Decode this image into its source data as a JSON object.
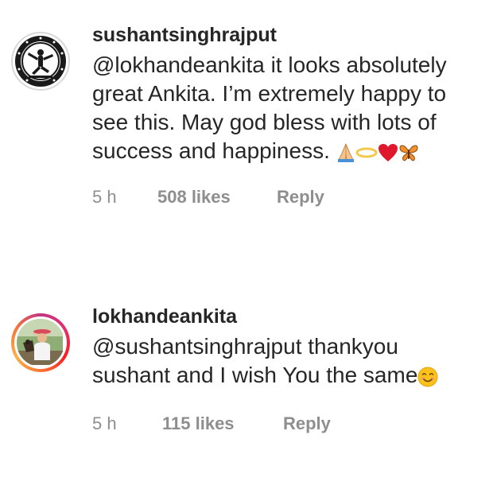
{
  "comments": [
    {
      "username": "sushantsinghrajput",
      "mention": "@lokhandeankita",
      "text": " it looks absolutely great Ankita. I’m extremely happy to see this. May god bless with lots of success and happiness.",
      "emojis": [
        "folded-hands-icon",
        "halo-icon",
        "red-heart-icon",
        "butterfly-icon"
      ],
      "time": "5 h",
      "likes": "508 likes",
      "reply": "Reply"
    },
    {
      "username": "lokhandeankita",
      "mention": "@sushantsinghrajput",
      "text": " thankyou sushant and I wish You the same",
      "emojis": [
        "smiling-face-icon"
      ],
      "time": "5 h",
      "likes": "115 likes",
      "reply": "Reply",
      "avatar_ring_colors": [
        "#c13584",
        "#e1306c",
        "#fd1d1d",
        "#f77737",
        "#fcaf45"
      ]
    }
  ],
  "colors": {
    "text": "#262626",
    "secondary": "#8e8e8e",
    "background": "#ffffff"
  }
}
